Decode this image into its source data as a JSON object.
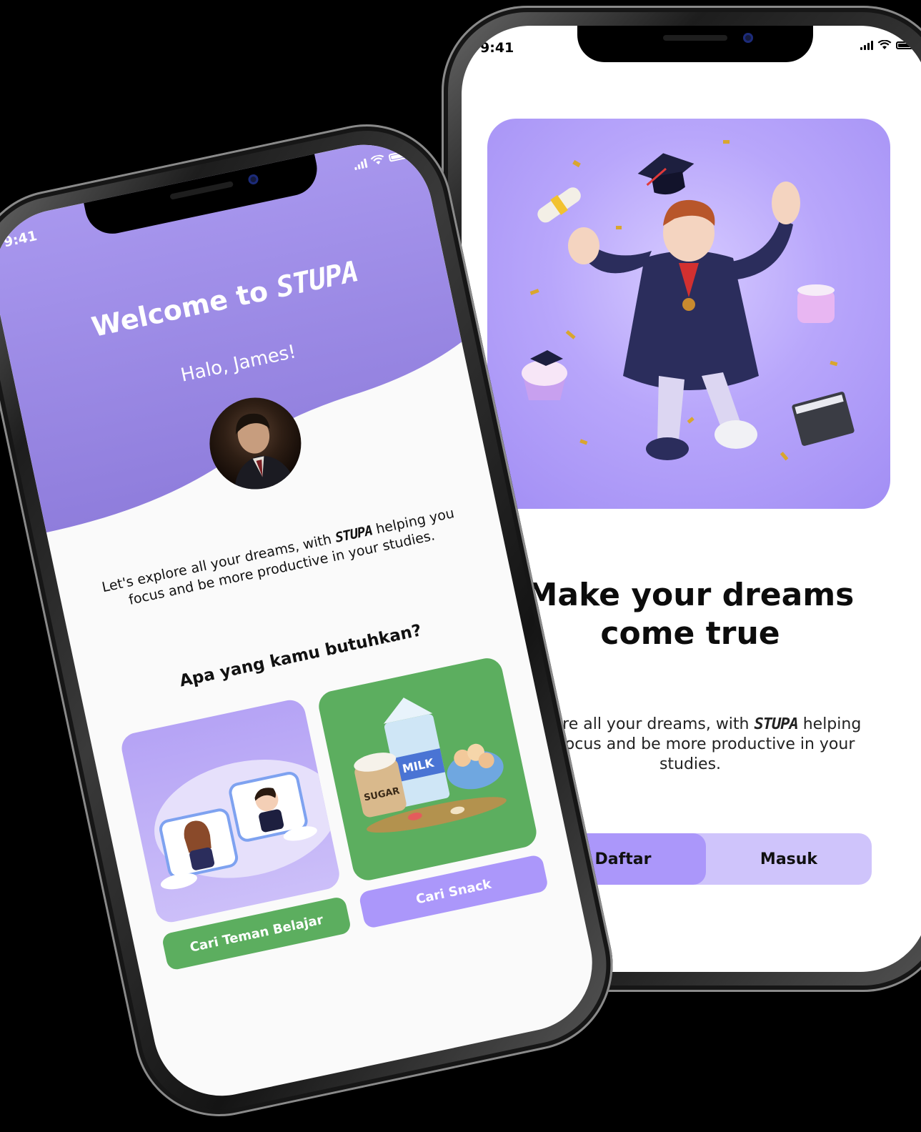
{
  "right_phone": {
    "status_time": "9:41",
    "hero_title": "Make your dreams come true",
    "desc_before_brand": "Explore all your dreams, with ",
    "brand": "STUPA",
    "desc_after_brand": " helping you focus and be more productive in your studies.",
    "buttons": {
      "daftar": "Daftar",
      "masuk": "Masuk"
    },
    "colors": {
      "accent": "#ab97fa",
      "segment_bg": "#cfc4fb"
    }
  },
  "left_phone": {
    "status_time": "9:41",
    "welcome_prefix": "Welcome to ",
    "brand": "STUPA",
    "greeting": "Halo, James!",
    "lead_before_brand": "Let's explore all your dreams, with ",
    "lead_after_brand": " helping you focus and be more productive in your studies.",
    "question": "Apa yang kamu butuhkan?",
    "tiles": [
      {
        "label": "Cari Teman Belajar",
        "icon": "study-friends-illustration"
      },
      {
        "label": "Cari Snack",
        "icon": "snack-groceries-illustration",
        "milk_text": "MILK",
        "sugar_text": "SUGAR"
      }
    ],
    "colors": {
      "header": "#9b89e6",
      "green": "#5cae5f",
      "lavender": "#ab97fa"
    }
  }
}
